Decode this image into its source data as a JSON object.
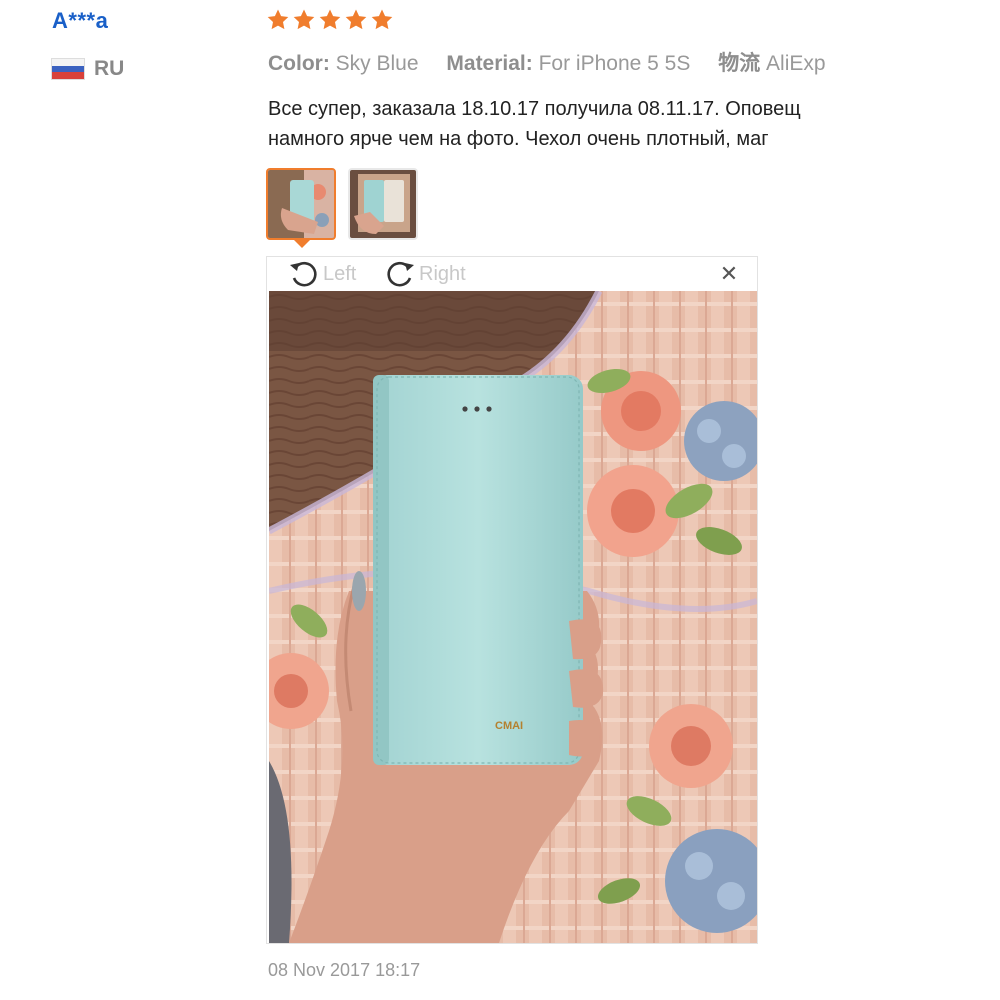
{
  "reviewer": {
    "name": "A***a",
    "country_code": "RU"
  },
  "rating": {
    "stars": 5,
    "max": 5,
    "color": "#f07d2d"
  },
  "attributes": [
    {
      "label": "Color:",
      "value": "Sky Blue"
    },
    {
      "label": "Material:",
      "value": "For iPhone 5 5S"
    },
    {
      "label": "物流",
      "value": "AliExp"
    }
  ],
  "review": {
    "line1": "Все супер, заказала 18.10.17 получила 08.11.17. Оповещ",
    "line2": "намного ярче чем на фото. Чехол очень плотный, маг"
  },
  "thumbnails": [
    {
      "icon": "phone-case-photo-thumbnail",
      "selected": true
    },
    {
      "icon": "open-case-photo-thumbnail",
      "selected": false
    }
  ],
  "viewer": {
    "rotate_left_label": "Left",
    "rotate_right_label": "Right",
    "close_icon": "close-icon",
    "photo_brand_text": "CMAI"
  },
  "timestamp": "08 Nov 2017 18:17",
  "colors": {
    "link_blue": "#1a60c8",
    "accent_orange": "#f07d2d",
    "case_blue": "#a9d8d6"
  }
}
